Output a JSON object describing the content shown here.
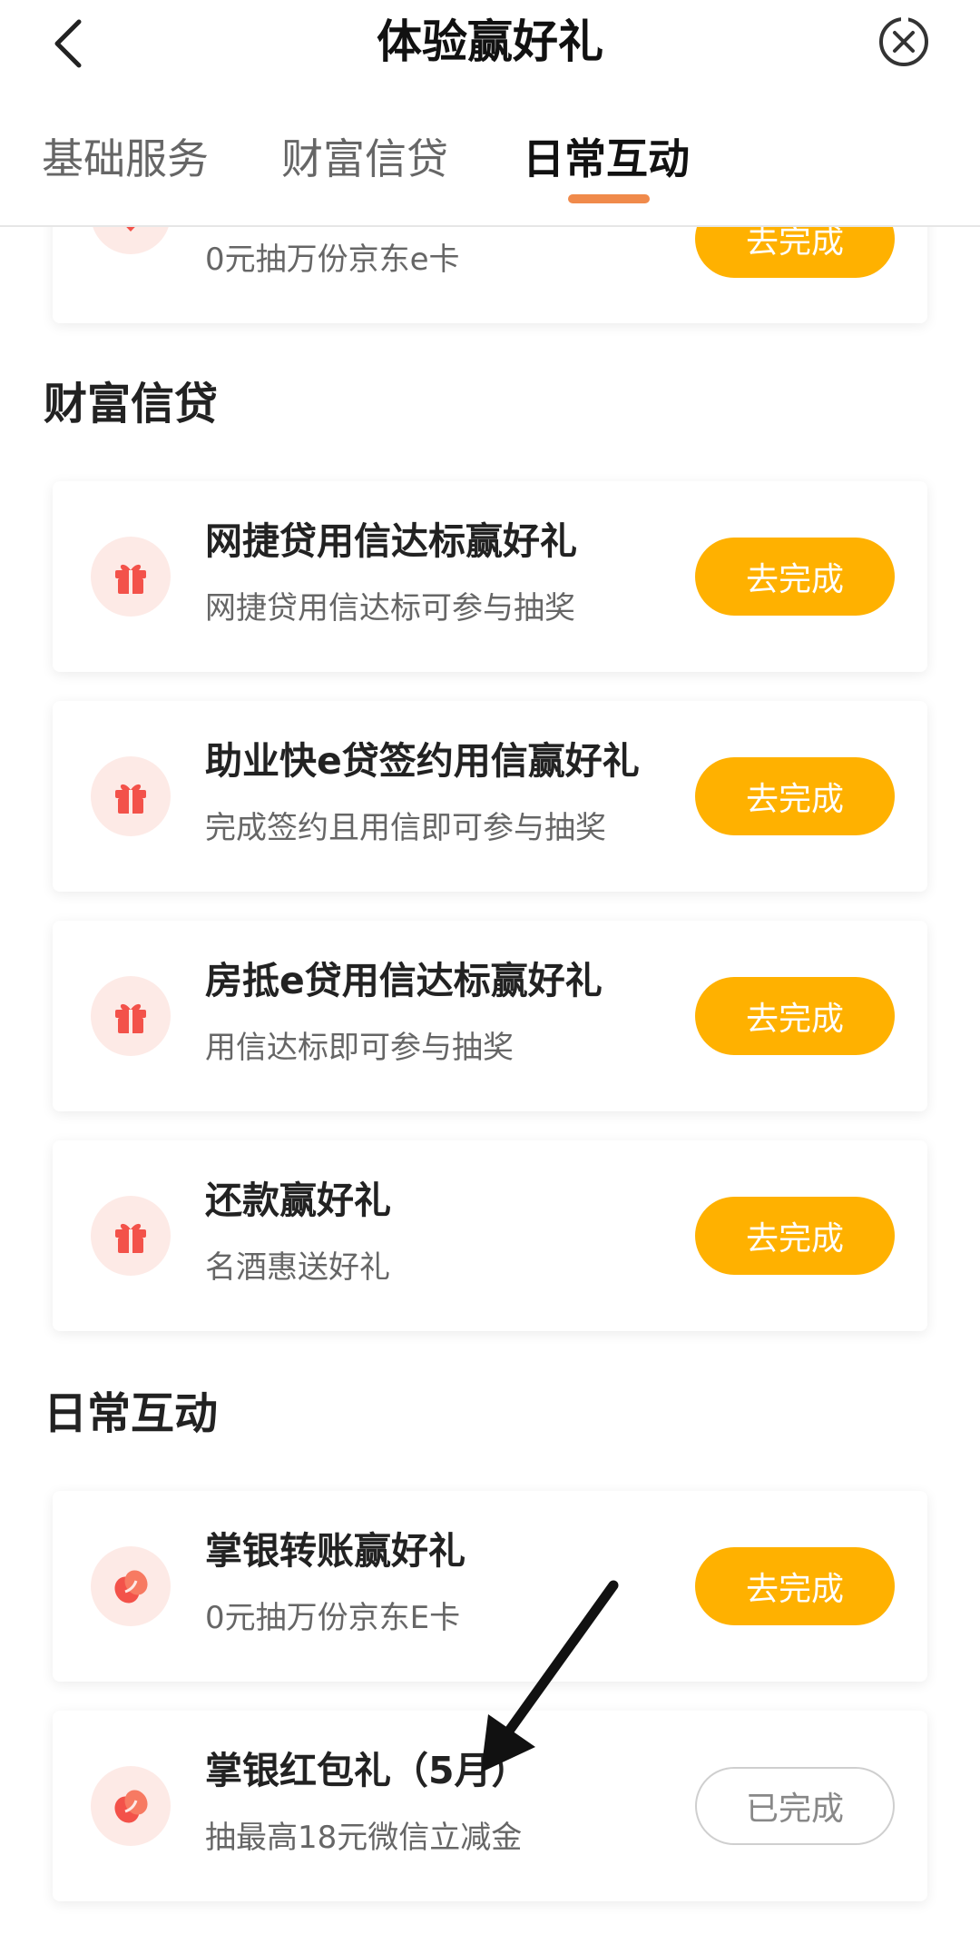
{
  "header": {
    "title": "体验赢好礼"
  },
  "tabs": [
    {
      "label": "基础服务"
    },
    {
      "label": "财富信贷"
    },
    {
      "label": "日常互动"
    }
  ],
  "top_partial_card": {
    "subtitle": "0元抽万份京东e卡",
    "button": "去完成"
  },
  "sections": {
    "wealth": {
      "title": "财富信贷",
      "items": [
        {
          "title": "网捷贷用信达标赢好礼",
          "subtitle": "网捷贷用信达标可参与抽奖",
          "button": "去完成"
        },
        {
          "title": "助业快e贷签约用信赢好礼",
          "subtitle": "完成签约且用信即可参与抽奖",
          "button": "去完成"
        },
        {
          "title": "房抵e贷用信达标赢好礼",
          "subtitle": "用信达标即可参与抽奖",
          "button": "去完成"
        },
        {
          "title": "还款赢好礼",
          "subtitle": "名酒惠送好礼",
          "button": "去完成"
        }
      ]
    },
    "daily": {
      "title": "日常互动",
      "items": [
        {
          "title": "掌银转账赢好礼",
          "subtitle": "0元抽万份京东E卡",
          "button": "去完成"
        },
        {
          "title": "掌银红包礼（5月）",
          "subtitle": "抽最高18元微信立减金",
          "button": "已完成"
        }
      ]
    }
  },
  "icons": {
    "back": "chevron-left-icon",
    "close": "close-circle-icon",
    "gift": "gift-icon",
    "transfer": "transfer-icon"
  },
  "colors": {
    "accent_button": "#ffb100",
    "icon_bg": "#fdeae6",
    "icon_red": "#f3524a",
    "tab_indicator": "#f08a4b"
  }
}
